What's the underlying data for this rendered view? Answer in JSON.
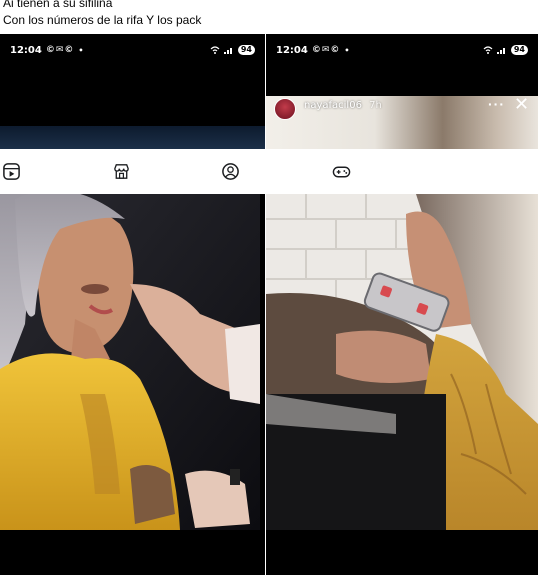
{
  "caption": {
    "line1": "Ai tienen a su sifilina",
    "line2": "Con los números de la rifa Y los pack"
  },
  "left_screen": {
    "status": {
      "time": "12:04",
      "notifications": "©✉©",
      "dot": "•",
      "battery": "94"
    }
  },
  "right_screen": {
    "status": {
      "time": "12:04",
      "notifications": "©✉©",
      "dot": "•",
      "battery": "94"
    },
    "story": {
      "username": "nayafacil06",
      "time_ago": "7h",
      "more": "···",
      "close": "✕"
    }
  },
  "nav": {
    "icons": [
      "reels-icon",
      "marketplace-icon",
      "profile-icon",
      "gaming-icon"
    ]
  },
  "colors": {
    "jacket_yellow": "#e8b62a",
    "phone_case": "#c8c6c9",
    "brick_wall": "#e9e7e4"
  }
}
